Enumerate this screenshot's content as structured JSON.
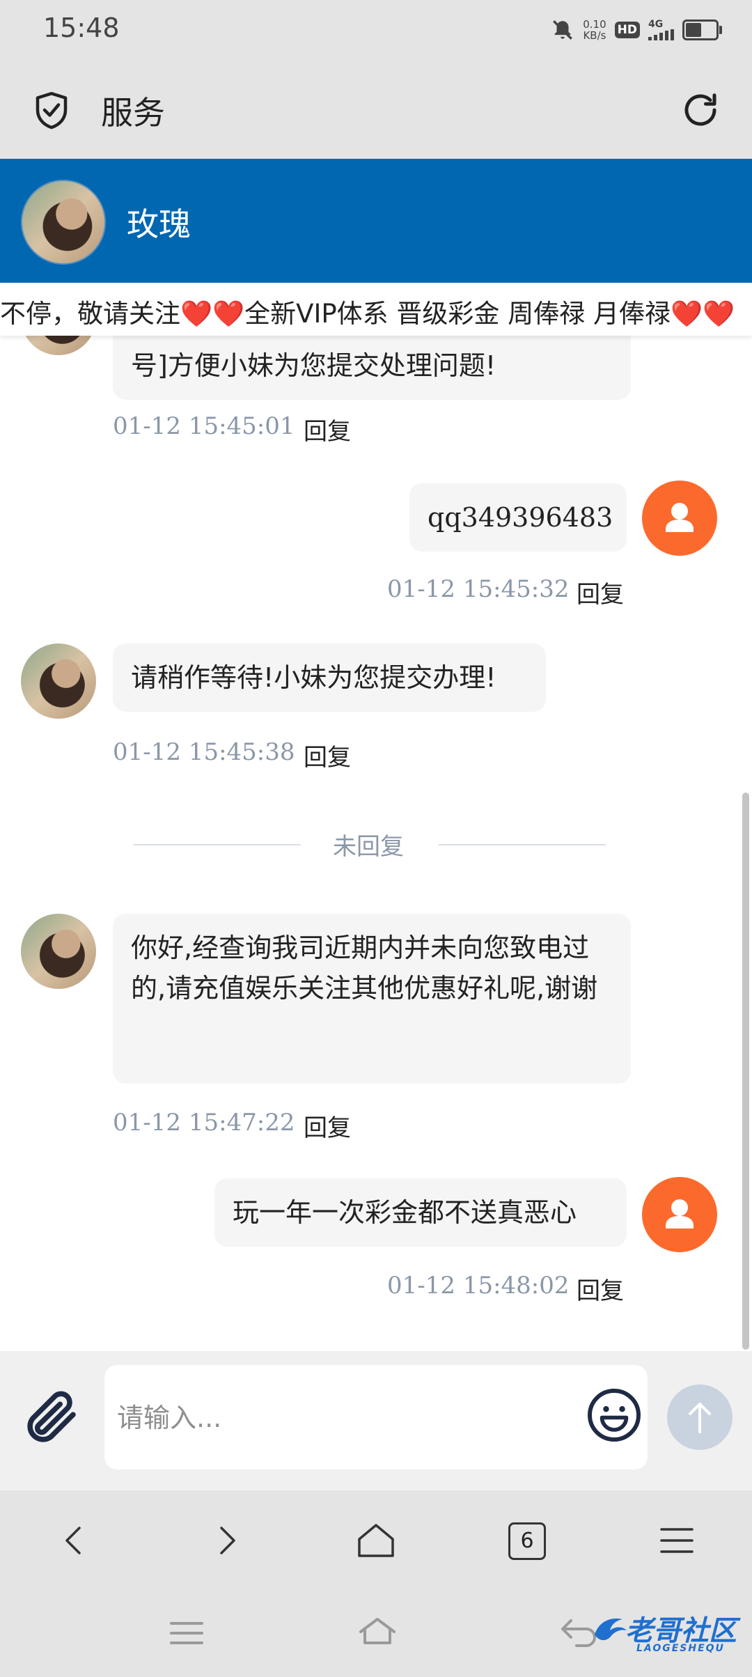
{
  "status_bar": {
    "time": "15:48",
    "net_speed_value": "0.10",
    "net_speed_unit": "KB/s",
    "hd_badge": "HD",
    "network": "4G",
    "icons": [
      "mute-bell-icon",
      "hd-icon",
      "signal-icon",
      "battery-icon"
    ],
    "battery_level": 0.48
  },
  "app_bar": {
    "title": "服务",
    "left_icon": "shield-check-icon",
    "right_icon": "refresh-icon"
  },
  "agent": {
    "name": "玫瑰"
  },
  "marquee": {
    "text": "不停，敬请关注❤️❤️全新VIP体系 晋级彩金 周俸禄 月俸禄❤️❤️"
  },
  "messages": [
    {
      "from": "agent",
      "text": "号]方便小妹为您提交处理问题!",
      "time": "01-12 15:45:01",
      "reply": "回复"
    },
    {
      "from": "user",
      "text": "qq349396483",
      "time": "01-12 15:45:32",
      "reply": "回复"
    },
    {
      "from": "agent",
      "text": "请稍作等待!小妹为您提交办理!",
      "time": "01-12 15:45:38",
      "reply": "回复"
    },
    {
      "from": "agent",
      "text": "你好,经查询我司近期内并未向您致电过的,请充值娱乐关注其他优惠好礼呢,谢谢",
      "time": "01-12 15:47:22",
      "reply": "回复"
    },
    {
      "from": "user",
      "text": "玩一年一次彩金都不送真恶心",
      "time": "01-12 15:48:02",
      "reply": "回复"
    }
  ],
  "divider": {
    "text": "未回复"
  },
  "input": {
    "placeholder": "请输入...",
    "value": "",
    "attach_icon": "paperclip-icon",
    "emoji_icon": "smiley-icon",
    "send_icon": "arrow-up-icon"
  },
  "browser_nav": {
    "tabs_count": "6",
    "icons": [
      "back-icon",
      "forward-icon",
      "home-icon",
      "tabs-icon",
      "menu-icon"
    ]
  },
  "system_nav": {
    "icons": [
      "recents-icon",
      "home-icon",
      "back-icon"
    ]
  },
  "watermark": {
    "text": "老哥社区",
    "subtext": "LAOGESHEQU"
  },
  "colors": {
    "header_blue": "#0067b0",
    "user_avatar": "#fb6a2c",
    "send_button": "#c9d3df",
    "meta_text": "#8a97a8"
  }
}
